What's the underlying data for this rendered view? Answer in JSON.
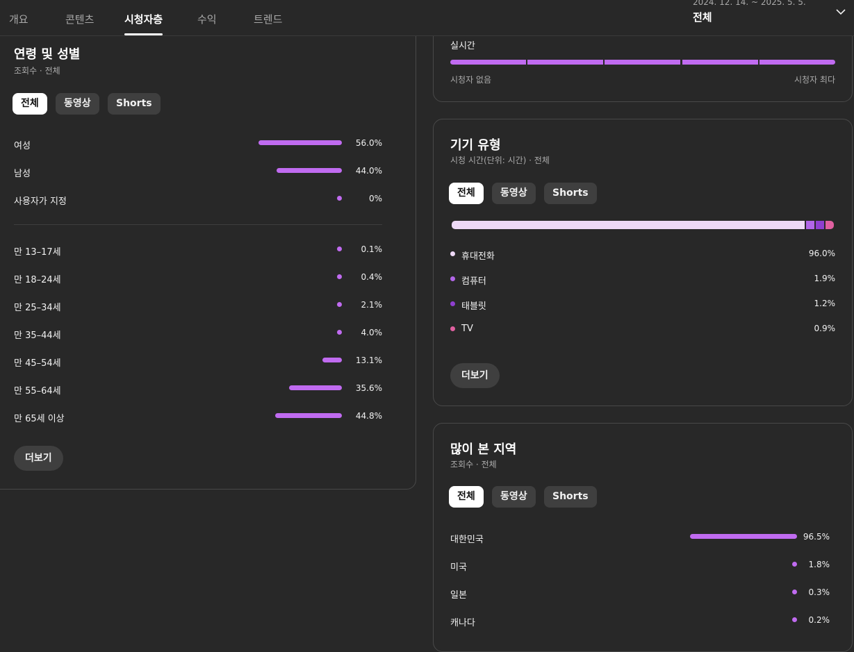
{
  "tabs": [
    {
      "label": "개요"
    },
    {
      "label": "콘텐츠"
    },
    {
      "label": "시청자층"
    },
    {
      "label": "수익"
    },
    {
      "label": "트렌드"
    }
  ],
  "date_range": "2024. 12. 14. ~ 2025. 5. 5.",
  "period_label": "전체",
  "colors": {
    "accent": "#c06bf0",
    "mobile": "#eed9f7",
    "computer": "#b266e8",
    "tablet": "#8f3fcf",
    "tv": "#e060a0"
  },
  "age_gender": {
    "title": "연령 및 성별",
    "subtitle": "조회수 · 전체",
    "chips": [
      "전체",
      "동영상",
      "Shorts"
    ],
    "gender": [
      {
        "label": "여성",
        "percent": 56.0,
        "value": "56.0%"
      },
      {
        "label": "남성",
        "percent": 44.0,
        "value": "44.0%"
      },
      {
        "label": "사용자가 지정",
        "percent": 0,
        "value": "0%"
      }
    ],
    "ages": [
      {
        "label": "만 13–17세",
        "percent": 0.1,
        "value": "0.1%"
      },
      {
        "label": "만 18–24세",
        "percent": 0.4,
        "value": "0.4%"
      },
      {
        "label": "만 25–34세",
        "percent": 2.1,
        "value": "2.1%"
      },
      {
        "label": "만 35–44세",
        "percent": 4.0,
        "value": "4.0%"
      },
      {
        "label": "만 45–54세",
        "percent": 13.1,
        "value": "13.1%"
      },
      {
        "label": "만 55–64세",
        "percent": 35.6,
        "value": "35.6%"
      },
      {
        "label": "만 65세 이상",
        "percent": 44.8,
        "value": "44.8%"
      }
    ],
    "more": "더보기"
  },
  "realtime": {
    "title": "실시간",
    "min_label": "시청자 없음",
    "max_label": "시청자 최다"
  },
  "device": {
    "title": "기기 유형",
    "subtitle": "시청 시간(단위: 시간) · 전체",
    "chips": [
      "전체",
      "동영상",
      "Shorts"
    ],
    "items": [
      {
        "label": "휴대전화",
        "percent": 96.0,
        "value": "96.0%",
        "color": "#eed9f7"
      },
      {
        "label": "컴퓨터",
        "percent": 1.9,
        "value": "1.9%",
        "color": "#b266e8"
      },
      {
        "label": "태블릿",
        "percent": 1.2,
        "value": "1.2%",
        "color": "#8f3fcf"
      },
      {
        "label": "TV",
        "percent": 0.9,
        "value": "0.9%",
        "color": "#e060a0"
      }
    ],
    "more": "더보기"
  },
  "geo": {
    "title": "많이 본 지역",
    "subtitle": "조회수 · 전체",
    "chips": [
      "전체",
      "동영상",
      "Shorts"
    ],
    "items": [
      {
        "label": "대한민국",
        "percent": 96.5,
        "value": "96.5%"
      },
      {
        "label": "미국",
        "percent": 1.8,
        "value": "1.8%"
      },
      {
        "label": "일본",
        "percent": 0.3,
        "value": "0.3%"
      },
      {
        "label": "캐나다",
        "percent": 0.2,
        "value": "0.2%"
      }
    ]
  }
}
